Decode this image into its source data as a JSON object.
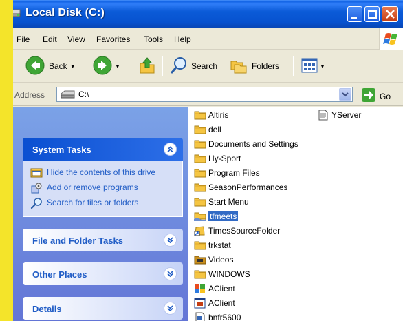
{
  "window": {
    "title": "Local Disk (C:)"
  },
  "menu": {
    "file": "File",
    "edit": "Edit",
    "view": "View",
    "favorites": "Favorites",
    "tools": "Tools",
    "help": "Help"
  },
  "toolbar": {
    "back": "Back",
    "search": "Search",
    "folders": "Folders"
  },
  "address": {
    "label": "Address",
    "value": "C:\\",
    "go": "Go"
  },
  "task_pane": {
    "system_tasks": {
      "title": "System Tasks",
      "items": [
        "Hide the contents of this drive",
        "Add or remove programs",
        "Search for files or folders"
      ]
    },
    "file_folder_tasks": {
      "title": "File and Folder Tasks"
    },
    "other_places": {
      "title": "Other Places"
    },
    "details": {
      "title": "Details"
    }
  },
  "files": {
    "col1": [
      {
        "name": "Altiris",
        "icon": "folder-icon"
      },
      {
        "name": "dell",
        "icon": "folder-icon"
      },
      {
        "name": "Documents and Settings",
        "icon": "folder-icon"
      },
      {
        "name": "Hy-Sport",
        "icon": "folder-icon"
      },
      {
        "name": "Program Files",
        "icon": "folder-icon"
      },
      {
        "name": "SeasonPerformances",
        "icon": "folder-icon"
      },
      {
        "name": "Start Menu",
        "icon": "folder-icon"
      },
      {
        "name": "tfmeets",
        "icon": "shared-folder-icon",
        "selected": true
      },
      {
        "name": "TimesSourceFolder",
        "icon": "shortcut-icon"
      },
      {
        "name": "trkstat",
        "icon": "folder-icon"
      },
      {
        "name": "Videos",
        "icon": "video-folder-icon"
      },
      {
        "name": "WINDOWS",
        "icon": "folder-icon"
      },
      {
        "name": "AClient",
        "icon": "app-icon"
      },
      {
        "name": "AClient",
        "icon": "window-app-icon"
      },
      {
        "name": "bnfr5600",
        "icon": "file-icon"
      }
    ],
    "col2": [
      {
        "name": "YServer",
        "icon": "text-file-icon"
      }
    ]
  },
  "colors": {
    "title_blue": "#0752cf",
    "task_blue": "#215dc6",
    "selection": "#316ac5",
    "folder_yellow": "#f5c542",
    "background_yellow": "#f4e42a"
  }
}
